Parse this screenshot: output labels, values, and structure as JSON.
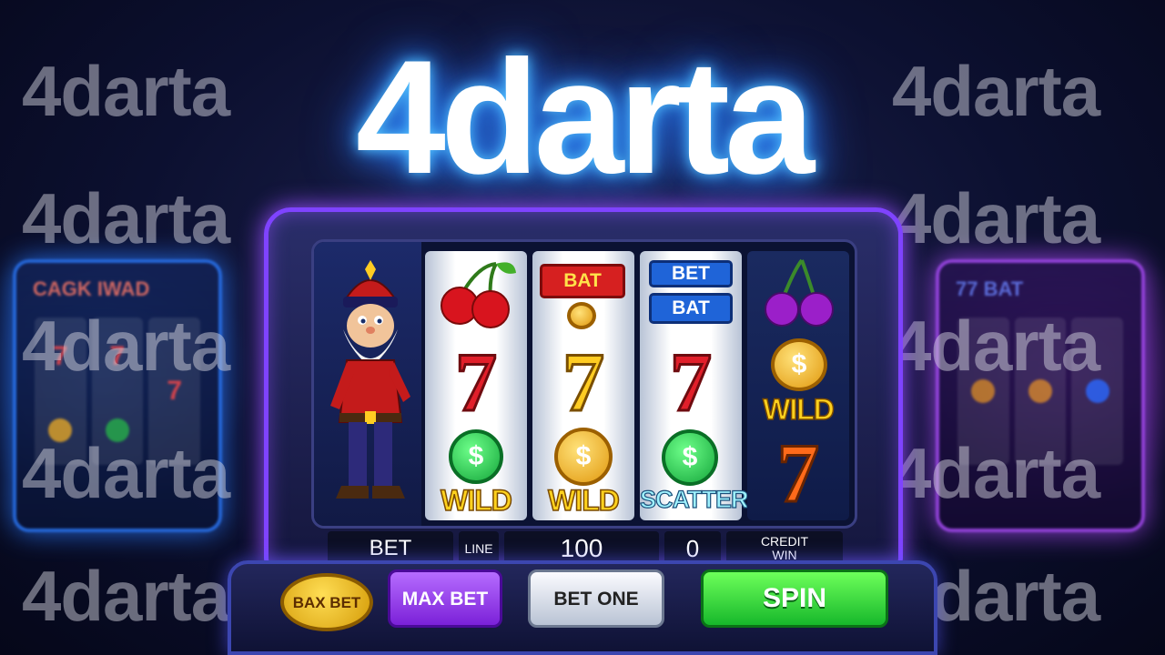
{
  "brand": "4darta",
  "watermarks": [
    "4darta",
    "4darta",
    "4darta",
    "4darta",
    "4darta",
    "4darta",
    "4darta",
    "4darta",
    "4darta",
    "4darta"
  ],
  "background_machines": {
    "left_title": "CAGK  IWAD",
    "right_title": "77  BAT"
  },
  "reels": [
    {
      "symbols": [
        "cherry",
        "red 7",
        "green dollar coin WILD"
      ],
      "wild_label": "WILD",
      "seven": "7"
    },
    {
      "symbols": [
        "BAT plate",
        "gold coin",
        "yellow 7",
        "gold dollar coin WILD"
      ],
      "plate": "BAT",
      "wild_label": "WILD",
      "seven": "7"
    },
    {
      "symbols": [
        "BET plate",
        "BAT plate",
        "red 7",
        "green dollar coin SCATTER"
      ],
      "plate_top": "BET",
      "plate_bottom": "BAT",
      "scatter_label": "SCATTER",
      "seven": "7"
    },
    {
      "symbols": [
        "purple cherry",
        "gold coin WILD",
        "orange 7"
      ],
      "wild_label": "WILD",
      "seven": "7"
    }
  ],
  "coin_symbol": "$",
  "info_bar": {
    "bet_label": "BET",
    "line_label": "LINE",
    "line_value": "100",
    "win_value": "0",
    "credit_label": "CREDIT",
    "win_label": "WIN"
  },
  "buttons": {
    "max_bet_gold": "BAX BET",
    "max_bet_purple": "MAX BET",
    "bet_one": "BET ONE",
    "spin": "SPIN"
  },
  "colors": {
    "logo_glow": "#2b8cff",
    "cabinet_border": "#7f43ff",
    "spin_green": "#17b82b",
    "max_bet_purple": "#7b21d8"
  }
}
